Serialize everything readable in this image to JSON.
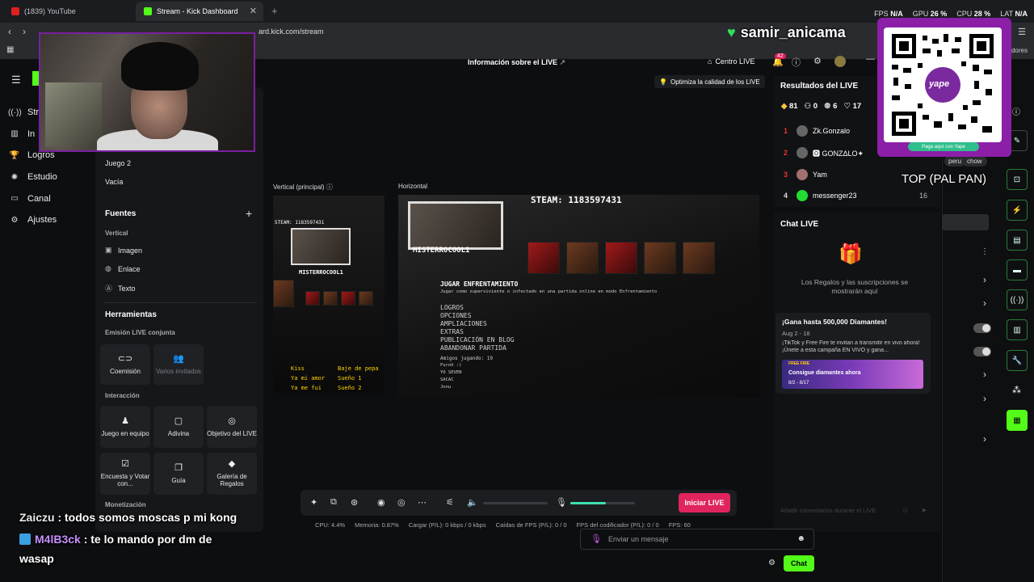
{
  "browser": {
    "tabs": [
      {
        "title": "(1839) YouTube"
      },
      {
        "title": "Stream - Kick Dashboard"
      }
    ],
    "url": "dashboard.kick.com/stream",
    "url_visible": "ard.kick.com/stream",
    "stats": {
      "fps_label": "FPS",
      "fps": "N/A",
      "gpu_label": "GPU",
      "gpu": "26 %",
      "cpu_label": "CPU",
      "cpu": "28 %",
      "lat_label": "LAT",
      "lat": "N/A"
    },
    "bookmarks_more": "dores"
  },
  "leftnav": {
    "items": [
      {
        "label": "Stre",
        "icon": "broadcast-icon"
      },
      {
        "label": "In",
        "icon": "chart-icon"
      },
      {
        "label": "Logros",
        "icon": "trophy-icon"
      },
      {
        "label": "Estudio",
        "icon": "gear-icon"
      },
      {
        "label": "Canal",
        "icon": "chat-icon"
      },
      {
        "label": "Ajustes",
        "icon": "settings-icon"
      }
    ]
  },
  "panel": {
    "juego2": "Juego 2",
    "vacia": "Vacía",
    "fuentes": "Fuentes",
    "vertical": "Vertical",
    "imagen": "Imagen",
    "enlace": "Enlace",
    "texto": "Texto",
    "herramientas": "Herramientas",
    "emision": "Emisión LIVE conjunta",
    "coemision": "Coemisión",
    "varios": "Varios invitados",
    "interaccion": "Interacción",
    "juego_equipo": "Juego en equipo",
    "adivina": "Adivina",
    "objetivo": "Objetivo del LIVE",
    "encuesta": "Encuesta y Votar con...",
    "guia": "Guía",
    "galeria": "Galería de Regalos",
    "monetizacion": "Monetización"
  },
  "header": {
    "info": "Información sobre el LIVE",
    "centro": "Centro LIVE",
    "notif_count": "42",
    "optimize": "Optimiza la calidad de los LIVE"
  },
  "previews": {
    "vertical_label": "Vertical (principal)",
    "horizontal_label": "Horizontal",
    "steam_id": "STEAM: 1183597431",
    "streamer_name": "MISTERROCOOL1",
    "menu_title": "JUGAR ENFRENTAMIENTO",
    "menu_desc": "Jugar como superviviente o infectado en una partida online en modo Enfrentamiento",
    "menu_items": [
      "LOGROS",
      "OPCIONES",
      "AMPLIACIONES",
      "EXTRAS",
      "PUBLICACIÓN EN BLOG",
      "ABANDONAR PARTIDA"
    ],
    "friends_playing": "Amigos jugando: 19",
    "friends": [
      "Furoh :)",
      "YO SEVEN",
      "SACAC",
      "Jonu"
    ],
    "vertical_gifts": [
      "Kiss",
      "Baje de pepa",
      "Ya mi amor",
      "Sueño 1",
      "Ya me fui",
      "Sueño 2"
    ]
  },
  "controls": {
    "start_label": "Iniciar LIVE",
    "mic_level": 0.55,
    "status": {
      "cpu": "CPU:  4.4%",
      "memoria": "Memoria:  0.87%",
      "cargar": "Cargar (P/L):  0 kbps / 0 kbps",
      "caidas": "Caídas de FPS (P/L):  0 / 0",
      "fps_cod": "FPS del codificador (P/L):  0 / 0",
      "fps": "FPS:  60"
    }
  },
  "results": {
    "title": "Resultados del LIVE",
    "stats": [
      "81",
      "0",
      "6",
      "17"
    ],
    "ranking": [
      {
        "rank": "1",
        "name": "Zk.Gonzalo",
        "value": ""
      },
      {
        "rank": "2",
        "name": "🅾 GONZΔLO✦",
        "value": ""
      },
      {
        "rank": "3",
        "name": "Yam",
        "value": ""
      },
      {
        "rank": "4",
        "name": "messenger23",
        "value": "16"
      }
    ]
  },
  "chatlive": {
    "title": "Chat LIVE",
    "empty": "Los Regalos y las suscripciones se mostrarán aquí",
    "promo_title": "¡Gana hasta 500,000 Diamantes!",
    "promo_date": "Aug 2 - 18",
    "promo_desc": "¡TikTok y Free Fire te invitan a transmitir en vivo ahora! ¡Únete a esta campaña EN VIVO y gana...",
    "promo_img_brand": "FREE FIRE",
    "promo_img_text": "Consigue diamantes ahora",
    "promo_img_date": "8/2 - 8/17",
    "comment_placeholder": "Añadir comentarios durante el LIVE"
  },
  "right": {
    "tags": [
      "peru",
      "chow"
    ]
  },
  "overlay": {
    "username": "samir_anicama",
    "qr_caption": "Paga aquí con Yape",
    "qr_brand": "yape",
    "top_text": "TOP (PAL PAN)",
    "chat": [
      {
        "user": "Zaiczu",
        "msg": " : todos somos moscas p mi kong"
      },
      {
        "user": "M4lB3ck",
        "msg": " : te lo mando por dm de"
      },
      {
        "user": "",
        "msg": "wasap"
      }
    ]
  },
  "chatbox": {
    "placeholder": "Enviar un mensaje",
    "send": "Chat"
  },
  "colors": {
    "kick_green": "#53fc18",
    "live_red": "#e0245e",
    "overlay_purple": "#8b1fa8"
  }
}
